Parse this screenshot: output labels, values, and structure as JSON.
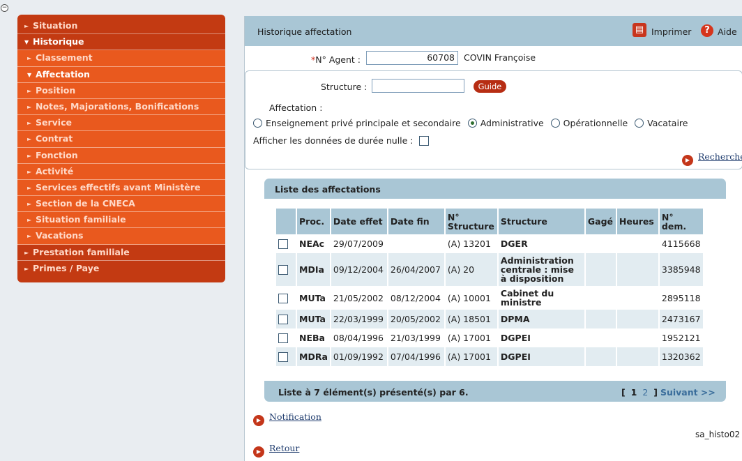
{
  "sidebar": {
    "items": [
      {
        "label": "Situation",
        "arrow": "►"
      },
      {
        "label": "Historique",
        "arrow": "▼"
      },
      {
        "label": "Classement",
        "arrow": "►"
      },
      {
        "label": "Affectation",
        "arrow": "▼"
      },
      {
        "label": "Position",
        "arrow": "►"
      },
      {
        "label": "Notes, Majorations, Bonifications",
        "arrow": "►"
      },
      {
        "label": "Service",
        "arrow": "►"
      },
      {
        "label": "Contrat",
        "arrow": "►"
      },
      {
        "label": "Fonction",
        "arrow": "►"
      },
      {
        "label": "Activité",
        "arrow": "►"
      },
      {
        "label": "Services effectifs avant Ministère",
        "arrow": "►"
      },
      {
        "label": "Section de la CNECA",
        "arrow": "►"
      },
      {
        "label": "Situation familiale",
        "arrow": "►"
      },
      {
        "label": "Vacations",
        "arrow": "►"
      },
      {
        "label": "Prestation familiale",
        "arrow": "►"
      },
      {
        "label": "Primes / Paye",
        "arrow": "►"
      }
    ]
  },
  "header": {
    "title": "Historique affectation",
    "print_label": "Imprimer",
    "help_label": "Aide",
    "help_glyph": "?"
  },
  "agent": {
    "required_mark": "*",
    "label": "N° Agent :",
    "value": "60708",
    "name": "COVIN Françoise"
  },
  "criteria": {
    "structure_label": "Structure :",
    "structure_value": "",
    "guide_label": "Guide",
    "affectation_label": "Affectation :",
    "options": [
      {
        "label": "Enseignement privé principale et secondaire",
        "selected": false
      },
      {
        "label": "Administrative",
        "selected": true
      },
      {
        "label": "Opérationnelle",
        "selected": false
      },
      {
        "label": "Vacataire",
        "selected": false
      }
    ],
    "null_label": "Afficher les données de durée nulle :",
    "search_label": "Rechercher"
  },
  "list": {
    "title": "Liste des affectations",
    "columns": [
      "Proc.",
      "Date effet",
      "Date fin",
      "N° Structure",
      "Structure",
      "Gagé",
      "Heures",
      "N° dem."
    ],
    "rows": [
      {
        "proc": "NEAc",
        "date_effet": "29/07/2009",
        "date_fin": "",
        "num_structure": "(A) 13201",
        "structure": "DGER",
        "gage": "",
        "heures": "",
        "num_dem": "4115668"
      },
      {
        "proc": "MDIa",
        "date_effet": "09/12/2004",
        "date_fin": "26/04/2007",
        "num_structure": "(A) 20",
        "structure": "Administration centrale : mise à disposition",
        "gage": "",
        "heures": "",
        "num_dem": "3385948"
      },
      {
        "proc": "MUTa",
        "date_effet": "21/05/2002",
        "date_fin": "08/12/2004",
        "num_structure": "(A) 10001",
        "structure": "Cabinet du ministre",
        "gage": "",
        "heures": "",
        "num_dem": "2895118"
      },
      {
        "proc": "MUTa",
        "date_effet": "22/03/1999",
        "date_fin": "20/05/2002",
        "num_structure": "(A) 18501",
        "structure": "DPMA",
        "gage": "",
        "heures": "",
        "num_dem": "2473167"
      },
      {
        "proc": "NEBa",
        "date_effet": "08/04/1996",
        "date_fin": "21/03/1999",
        "num_structure": "(A) 17001",
        "structure": "DGPEI",
        "gage": "",
        "heures": "",
        "num_dem": "1952121"
      },
      {
        "proc": "MDRa",
        "date_effet": "01/09/1992",
        "date_fin": "07/04/1996",
        "num_structure": "(A) 17001",
        "structure": "DGPEI",
        "gage": "",
        "heures": "",
        "num_dem": "1320362"
      }
    ],
    "footer": "Liste à 7 élément(s) présenté(s) par 6.",
    "pager": {
      "open": "[",
      "current": "1",
      "other": "2",
      "close": "]",
      "next": "Suivant >>"
    }
  },
  "links": {
    "notification": "Notification",
    "back": "Retour"
  },
  "screen_code": "sa_histo02",
  "colors": {
    "sidebar": "#c33a12",
    "sidebar_sub": "#e9591e",
    "header": "#a9c6d5",
    "accent": "#c4361a"
  }
}
